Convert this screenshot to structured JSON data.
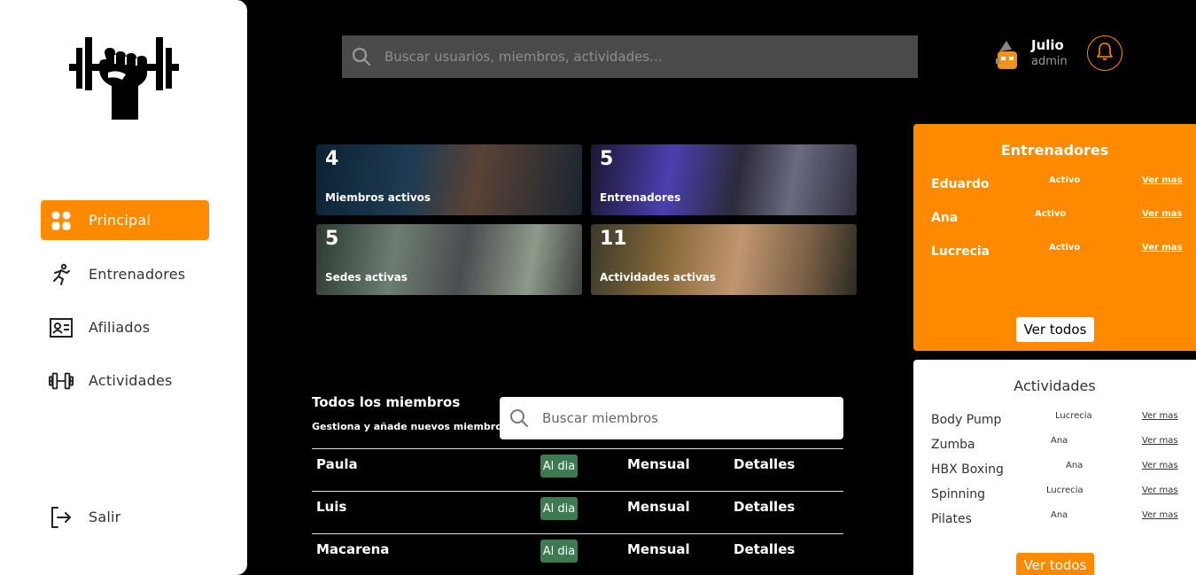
{
  "sidebar": {
    "items": [
      {
        "label": "Principal",
        "icon": "grid-icon"
      },
      {
        "label": "Entrenadores",
        "icon": "running-person-icon"
      },
      {
        "label": "Afiliados",
        "icon": "id-card-icon"
      },
      {
        "label": "Actividades",
        "icon": "dumbbell-icon"
      }
    ],
    "logout": {
      "label": "Salir",
      "icon": "logout-icon"
    }
  },
  "topbar": {
    "search_placeholder": "Buscar usuarios, miembros, actividades...",
    "user": {
      "name": "Julio",
      "role": "admin"
    }
  },
  "stats": [
    {
      "value": "4",
      "label": "Miembros activos"
    },
    {
      "value": "5",
      "label": "Entrenadores"
    },
    {
      "value": "5",
      "label": "Sedes activas"
    },
    {
      "value": "11",
      "label": "Actividades activas"
    }
  ],
  "members": {
    "title": "Todos los miembros",
    "subtitle": "Gestiona y añade nuevos miembros",
    "search_placeholder": "Buscar miembros",
    "rows": [
      {
        "name": "Paula",
        "status": "Al dia",
        "plan": "Mensual",
        "action": "Detalles"
      },
      {
        "name": "Luis",
        "status": "Al dia",
        "plan": "Mensual",
        "action": "Detalles"
      },
      {
        "name": "Macarena",
        "status": "Al dia",
        "plan": "Mensual",
        "action": "Detalles"
      }
    ]
  },
  "trainers": {
    "title": "Entrenadores",
    "rows": [
      {
        "name": "Eduardo",
        "status": "Activo",
        "link": "Ver mas"
      },
      {
        "name": "Ana",
        "status": "Activo",
        "link": "Ver mas"
      },
      {
        "name": "Lucrecia",
        "status": "Activo",
        "link": "Ver mas"
      }
    ],
    "button": "Ver todos"
  },
  "activities": {
    "title": "Actividades",
    "rows": [
      {
        "name": "Body Pump",
        "trainer": "Lucrecia",
        "link": "Ver mas"
      },
      {
        "name": "Zumba",
        "trainer": "Ana",
        "link": "Ver mas"
      },
      {
        "name": "HBX Boxing",
        "trainer": "Ana",
        "link": "Ver mas"
      },
      {
        "name": "Spinning",
        "trainer": "Lucrecia",
        "link": "Ver mas"
      },
      {
        "name": "Pilates",
        "trainer": "Ana",
        "link": "Ver mas"
      }
    ],
    "button": "Ver todos"
  },
  "colors": {
    "accent": "#ff8a00",
    "status_green": "#3d7a52",
    "search_bg": "#4a4a4a"
  }
}
